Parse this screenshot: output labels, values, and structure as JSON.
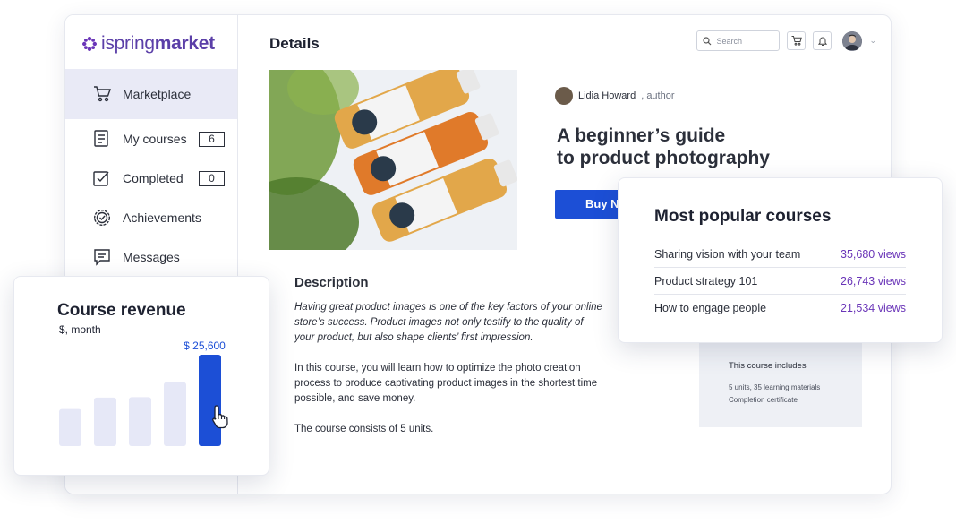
{
  "brand": {
    "name_light": "ispring",
    "name_bold": "market",
    "color": "#5b3fa8"
  },
  "sidebar": {
    "items": [
      {
        "label": "Marketplace",
        "icon": "cart-icon",
        "active": true
      },
      {
        "label": "My courses",
        "icon": "courses-icon",
        "count": "6"
      },
      {
        "label": "Completed",
        "icon": "checklist-icon",
        "count": "0"
      },
      {
        "label": "Achievements",
        "icon": "badge-icon"
      },
      {
        "label": "Messages",
        "icon": "message-icon"
      }
    ]
  },
  "header": {
    "title": "Details",
    "search_placeholder": "Search"
  },
  "course": {
    "author_name": "Lidia Howard",
    "author_role": ", author",
    "title": "A beginner’s guide\nto product photography",
    "buy_label": "Buy Now"
  },
  "description": {
    "heading": "Description",
    "paragraphs": [
      "Having great product images is one of the key factors of your online store’s success. Product images not only testify to the quality of your product, but also shape clients’ first impression.",
      "In this course, you will learn how to optimize the photo creation process to produce captivating product images in the shortest time possible, and save money.",
      "The course consists of 5 units."
    ]
  },
  "includes": {
    "heading": "This course includes",
    "line1": "5 units, 35 learning materials",
    "line2": "Completion certificate"
  },
  "popular": {
    "title": "Most popular courses",
    "rows": [
      {
        "name": "Sharing vision with your team",
        "views": "35,680 views"
      },
      {
        "name": "Product strategy 101",
        "views": "26,743 views"
      },
      {
        "name": "How to engage people",
        "views": "21,534 views"
      }
    ]
  },
  "revenue": {
    "title": "Course revenue",
    "unit": "$, month"
  },
  "chart_data": {
    "type": "bar",
    "title": "Course revenue",
    "ylabel": "$, month",
    "values": [
      10400,
      13600,
      13700,
      17900,
      25600
    ],
    "highlight_index": 4,
    "highlight_label": "$ 25,600",
    "highlight_color": "#1c4fd6",
    "bar_color": "#e6e8f7"
  },
  "colors": {
    "accent": "#1c4fd6",
    "views": "#6a35b8",
    "active_nav": "#e9eaf6"
  }
}
